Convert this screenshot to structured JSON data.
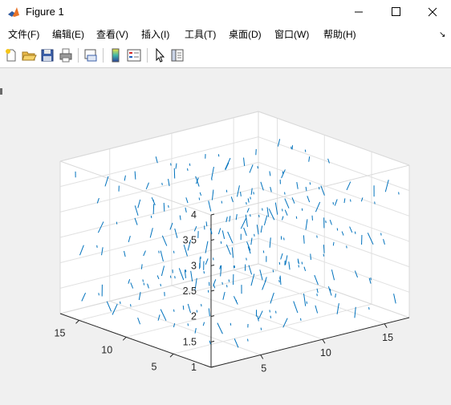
{
  "window": {
    "title": "Figure 1"
  },
  "menu": [
    "文件(F)",
    "编辑(E)",
    "查看(V)",
    "插入(I)",
    "工具(T)",
    "桌面(D)",
    "窗口(W)",
    "帮助(H)"
  ],
  "menu_overflow": "↘",
  "toolbar": [
    "new-figure",
    "open-file",
    "save",
    "print",
    "link-plot",
    "insert-colorbar",
    "insert-legend",
    "edit-plot",
    "property-inspector"
  ],
  "chart_data": {
    "type": "quiver3",
    "color": "#0072bd",
    "xlim": [
      1,
      17
    ],
    "ylim": [
      1,
      17
    ],
    "zlim": [
      1,
      4
    ],
    "x_ticks": [
      "5",
      "10",
      "15"
    ],
    "y_ticks": [
      "5",
      "10",
      "15"
    ],
    "z_ticks": [
      "1",
      "1.5",
      "2",
      "2.5",
      "3",
      "3.5",
      "4"
    ],
    "grid": true,
    "box": true,
    "z_layers": [
      1.5,
      2.5,
      3.5
    ],
    "grid_step": 2
  }
}
